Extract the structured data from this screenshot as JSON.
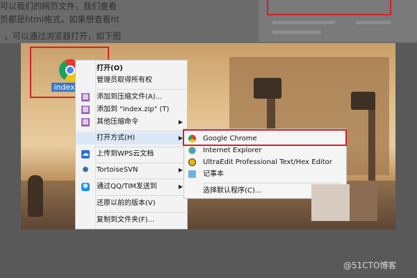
{
  "article": {
    "line1": "可以我们的网页文件，我们查看",
    "line2": "页都是html格式，如果想查看ht",
    "line3": "，可以通过浏览器打开，如下图"
  },
  "file": {
    "name": "index.ht"
  },
  "context_menu": {
    "items": [
      {
        "label": "打开(O)",
        "icon": "none"
      },
      {
        "label": "管理员取得所有权",
        "icon": "none"
      },
      {
        "label": "添加到压缩文件(A)...",
        "icon": "archive-icon"
      },
      {
        "label": "添加到 \"index.zip\" (T)",
        "icon": "archive-icon"
      },
      {
        "label": "其他压缩命令",
        "icon": "archive-icon"
      },
      {
        "label": "打开方式(H)",
        "icon": "none"
      },
      {
        "label": "上传到WPS云文档",
        "icon": "wps-cloud-icon"
      },
      {
        "label": "TortoiseSVN",
        "icon": "tortoise-icon"
      },
      {
        "label": "通过QQ/TIM发送到",
        "icon": "qq-icon"
      },
      {
        "label": "还原以前的版本(V)",
        "icon": "none"
      },
      {
        "label": "复制到文件夹(F)...",
        "icon": "none"
      }
    ]
  },
  "open_with_menu": {
    "items": [
      {
        "label": "Google Chrome",
        "icon": "chrome-icon"
      },
      {
        "label": "Internet Explorer",
        "icon": "ie-icon"
      },
      {
        "label": "UltraEdit Professional Text/Hex Editor",
        "icon": "ultraedit-icon"
      },
      {
        "label": "记事本",
        "icon": "notepad-icon"
      },
      {
        "label": "选择默认程序(C)...",
        "icon": "none"
      }
    ]
  },
  "watermark": "@51CTO博客",
  "colors": {
    "highlight_red": "#d0212a",
    "menu_bg": "#f3f3f3",
    "hover_bg": "#dbe8f7"
  }
}
